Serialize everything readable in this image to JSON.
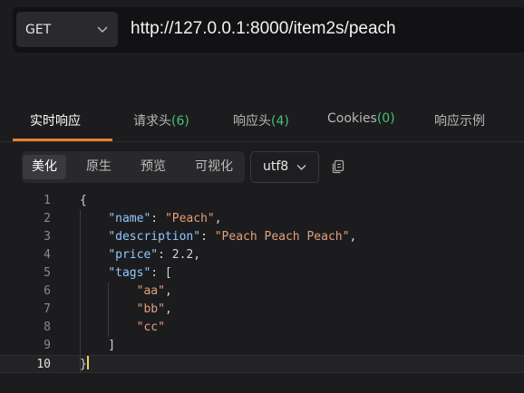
{
  "request": {
    "method": "GET",
    "url": "http://127.0.0.1:8000/item2s/peach"
  },
  "tabs": [
    {
      "label": "实时响应",
      "count": ""
    },
    {
      "label": "请求头",
      "count": "(6)"
    },
    {
      "label": "响应头",
      "count": "(4)"
    },
    {
      "label": "Cookies",
      "count": "(0)"
    },
    {
      "label": "响应示例",
      "count": ""
    }
  ],
  "view_modes": [
    "美化",
    "原生",
    "预览",
    "可视化"
  ],
  "encoding": "utf8",
  "icons": {
    "method_dropdown": "chevron-down-icon",
    "encoding_dropdown": "chevron-down-icon",
    "copy": "copy-icon"
  },
  "colors": {
    "accent": "#e8822b",
    "count": "#46c27a",
    "json_key": "#8fc8ff",
    "json_string": "#e2a07a"
  },
  "code_lines": [
    {
      "n": "1",
      "t": "{"
    },
    {
      "n": "2",
      "t": "    \"name\": \"Peach\","
    },
    {
      "n": "3",
      "t": "    \"description\": \"Peach Peach Peach\","
    },
    {
      "n": "4",
      "t": "    \"price\": 2.2,"
    },
    {
      "n": "5",
      "t": "    \"tags\": ["
    },
    {
      "n": "6",
      "t": "        \"aa\","
    },
    {
      "n": "7",
      "t": "        \"bb\","
    },
    {
      "n": "8",
      "t": "        \"cc\""
    },
    {
      "n": "9",
      "t": "    ]"
    },
    {
      "n": "10",
      "t": "}"
    }
  ]
}
